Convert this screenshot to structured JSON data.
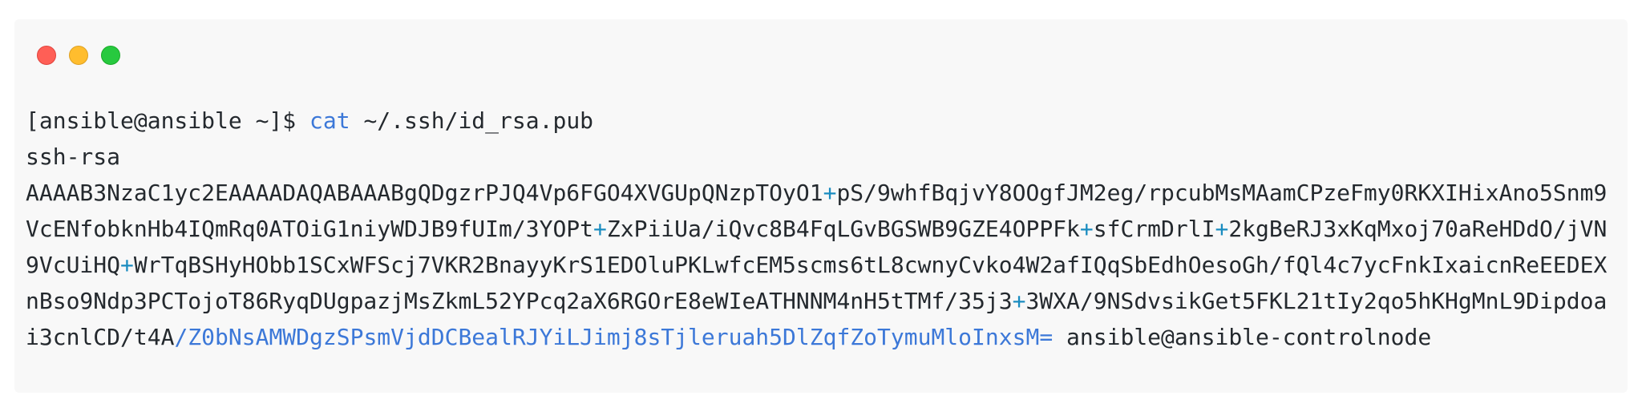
{
  "window": {
    "controls": [
      "close",
      "minimize",
      "maximize"
    ],
    "colors": {
      "close": "#ff5f56",
      "minimize": "#ffbd2e",
      "maximize": "#27c93f"
    }
  },
  "terminal": {
    "prompt": "[ansible@ansible ~]$ ",
    "command": "cat",
    "argument": " ~/.ssh/id_rsa.pub",
    "key_type": "ssh-rsa",
    "key_lines": [
      [
        "AAAAB3NzaC1yc2EAAAADAQABAAABgQDgzrPJQ4Vp6FGO4XVGUpQNzpTOyO1",
        "+",
        "pS/9whfBqjvY8OOgfJM2eg/rpcubMsMAamCPzeFmy0RKXIHixAno5Snm9"
      ],
      [
        "VcENfobknHb4IQmRq0ATOiG1niyWDJB9fUIm/3YOPt",
        "+",
        "ZxPiiUa/iQvc8B4FqLGvBGSWB9GZE4OPPFk",
        "+",
        "sfCrmDrlI",
        "+",
        "2kgBeRJ3xKqMxoj70aReHDdO/jVN"
      ],
      [
        "9VcUiHQ",
        "+",
        "WrTqBSHyHObb1SCxWFScj7VKR2BnayyKrS1EDOluPKLwfcEM5scms6tL8cwnyCvko4W2afIQqSbEdhOesoGh/fQl4c7ycFnkIxaicnReEEDEX"
      ],
      [
        "nBso9Ndp3PCTojoT86RyqDUgpazjMsZkmL52YPcq2aX6RGOrE8eWIeATHNNM4nH5tTMf/35j3",
        "+",
        "3WXA/9NSdvsikGet5FKL21tIy2qo5hKHgMnL9Dipdoa"
      ],
      [
        "i3cnlCD/t4A",
        "/Z0bNsAMWDgzSPsmVjdDCBealRJYiLJimj8sTjleruah5DlZqfZoTymuMloInxsM=",
        " ansible@ansible-controlnode"
      ]
    ]
  }
}
